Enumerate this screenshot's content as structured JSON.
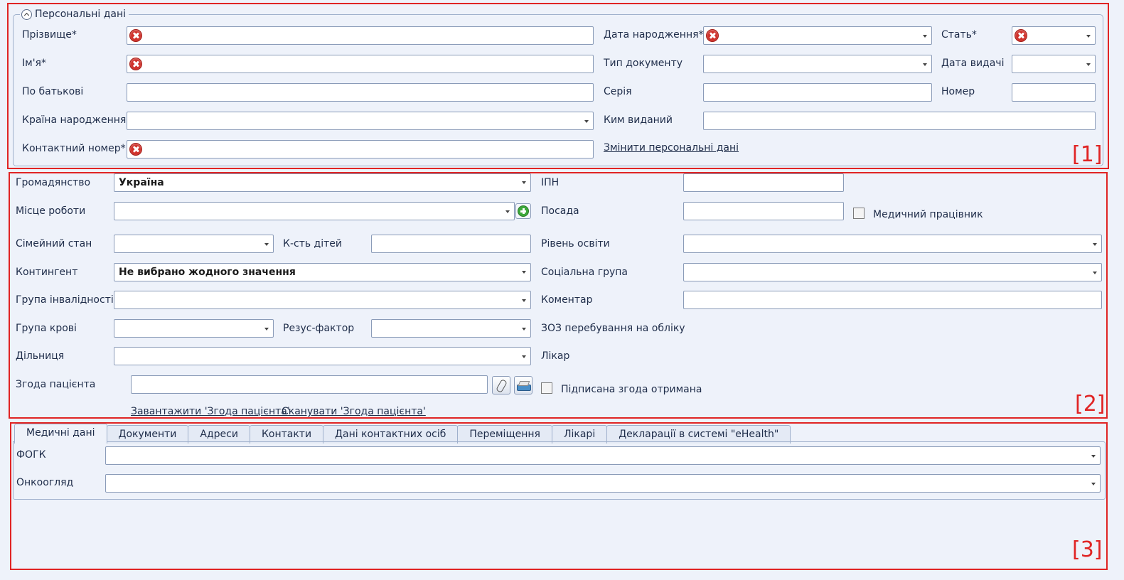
{
  "personal": {
    "group_title": "Персональні дані",
    "surname_label": "Прізвище*",
    "name_label": "Ім'я*",
    "patronymic_label": "По батькові",
    "birth_country_label": "Країна народження",
    "contact_phone_label": "Контактний номер*",
    "birth_date_label": "Дата народження*",
    "doc_type_label": "Тип документу",
    "series_label": "Серія",
    "issued_by_label": "Ким виданий",
    "change_link": "Змінити персональні дані",
    "sex_label": "Стать*",
    "issue_date_label": "Дата видачі",
    "number_label": "Номер",
    "section_num": "[1]"
  },
  "general": {
    "citizenship_label": "Громадянство",
    "citizenship_value": "Україна",
    "workplace_label": "Місце роботи",
    "marital_label": "Сімейний стан",
    "children_label": "К-сть дітей",
    "contingent_label": "Контингент",
    "contingent_value": "Не вибрано жодного значення",
    "disability_label": "Група інвалідності",
    "blood_label": "Група крові",
    "rh_label": "Резус-фактор",
    "district_label": "Дільниця",
    "consent_label": "Згода пацієнта",
    "upload_link": "Завантажити 'Згода пацієнта'",
    "scan_link": "Сканувати 'Згода пацієнта'",
    "ipn_label": "ІПН",
    "position_label": "Посада",
    "medical_worker_label": "Медичний працівник",
    "education_label": "Рівень освіти",
    "social_label": "Соціальна група",
    "comment_label": "Коментар",
    "zoz_label": "ЗОЗ перебування на обліку",
    "doctor_label": "Лікар",
    "signed_label": "Підписана згода отримана",
    "section_num": "[2]"
  },
  "tabs": [
    {
      "label": "Медичні дані"
    },
    {
      "label": "Документи"
    },
    {
      "label": "Адреси"
    },
    {
      "label": "Контакти"
    },
    {
      "label": "Дані контактних осіб"
    },
    {
      "label": "Переміщення"
    },
    {
      "label": "Лікарі"
    },
    {
      "label": "Декларації в системі \"eHealth\""
    }
  ],
  "medical": {
    "fogk_label": "ФОГК",
    "onco_label": "Онкоогляд",
    "section_num": "[3]"
  },
  "colors": {
    "accent_red": "#e02424",
    "error_icon": "#d0322c",
    "background": "#eef2fa"
  }
}
